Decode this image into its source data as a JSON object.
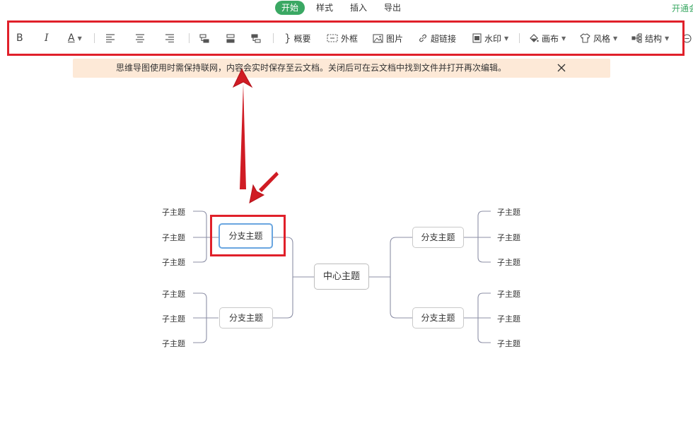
{
  "menu": {
    "tabs": [
      "开始",
      "样式",
      "插入",
      "导出"
    ],
    "active_tab": "开始",
    "right_link": "开通会员"
  },
  "toolbar": {
    "bold": "B",
    "italic": "I",
    "font_color": "A",
    "summary": "概要",
    "frame": "外框",
    "image": "图片",
    "link": "超链接",
    "watermark": "水印",
    "canvas": "画布",
    "style": "风格",
    "structure": "结构"
  },
  "notice": {
    "text": "思维导图使用时需保持联网，内容会实时保存至云文档。关闭后可在云文档中找到文件并打开再次编辑。"
  },
  "mindmap": {
    "center": "中心主题",
    "branches": [
      {
        "label": "分支主题",
        "side": "left",
        "selected": true,
        "children": [
          "子主题",
          "子主题",
          "子主题"
        ]
      },
      {
        "label": "分支主题",
        "side": "left",
        "selected": false,
        "children": [
          "子主题",
          "子主题",
          "子主题"
        ]
      },
      {
        "label": "分支主题",
        "side": "right",
        "selected": false,
        "children": [
          "子主题",
          "子主题",
          "子主题"
        ]
      },
      {
        "label": "分支主题",
        "side": "right",
        "selected": false,
        "children": [
          "子主题",
          "子主题",
          "子主题"
        ]
      }
    ]
  },
  "colors": {
    "accent_green": "#3aa863",
    "annotation_red": "#e0202a",
    "notice_bg": "#fde9d7",
    "connector": "#8c8fa6",
    "selected_border": "#6aa6e0"
  }
}
